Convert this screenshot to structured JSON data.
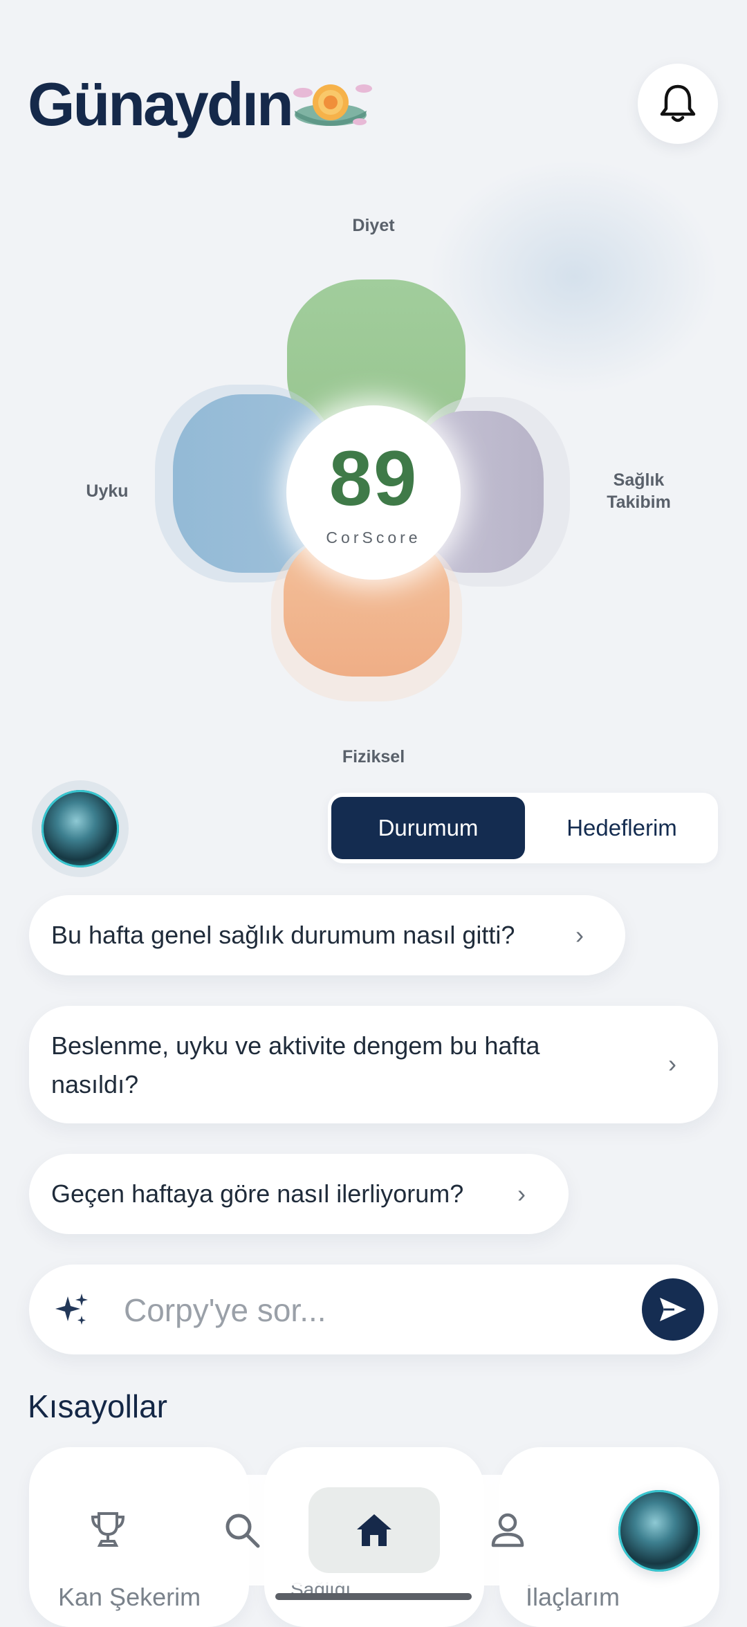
{
  "header": {
    "greeting": "Günaydın",
    "greeting_emoji": "sunrise-illustration",
    "notification_icon": "bell-icon"
  },
  "score_flower": {
    "labels": {
      "top": "Diyet",
      "left": "Uyku",
      "right_line1": "Sağlık",
      "right_line2": "Takibim",
      "bottom": "Fiziksel"
    },
    "score": "89",
    "score_label": "CorScore",
    "colors": {
      "diyet": "#a1cd9c",
      "uyku": "#93bad6",
      "saglik": "#c6c3d6",
      "fiziksel": "#f3c09a",
      "score_text": "#3f7a48"
    }
  },
  "assistant": {
    "avatar_icon": "ai-orb-icon"
  },
  "toggle": {
    "active_label": "Durumum",
    "inactive_label": "Hedeflerim"
  },
  "suggestions": [
    {
      "line1": "Bu hafta genel sağlık durumum nasıl gitti?"
    },
    {
      "line1": "Beslenme, uyku ve aktivite dengem bu hafta",
      "line2": "nasıldı?"
    },
    {
      "line1": "Geçen haftaya göre nasıl ilerliyorum?"
    }
  ],
  "ask": {
    "placeholder": "Corpy'ye sor...",
    "sparkle_icon": "sparkle-icon",
    "send_icon": "send-icon"
  },
  "shortcuts": {
    "title": "Kısayollar",
    "items": [
      {
        "label": "Kan Şekerim"
      },
      {
        "label": "Sağlığı"
      },
      {
        "label": "İlaçlarım"
      }
    ]
  },
  "bottom_nav": {
    "items": [
      "trophy-icon",
      "search-icon",
      "home-icon",
      "profile-icon"
    ],
    "active": "home-icon"
  },
  "brand_color": "#142c50"
}
